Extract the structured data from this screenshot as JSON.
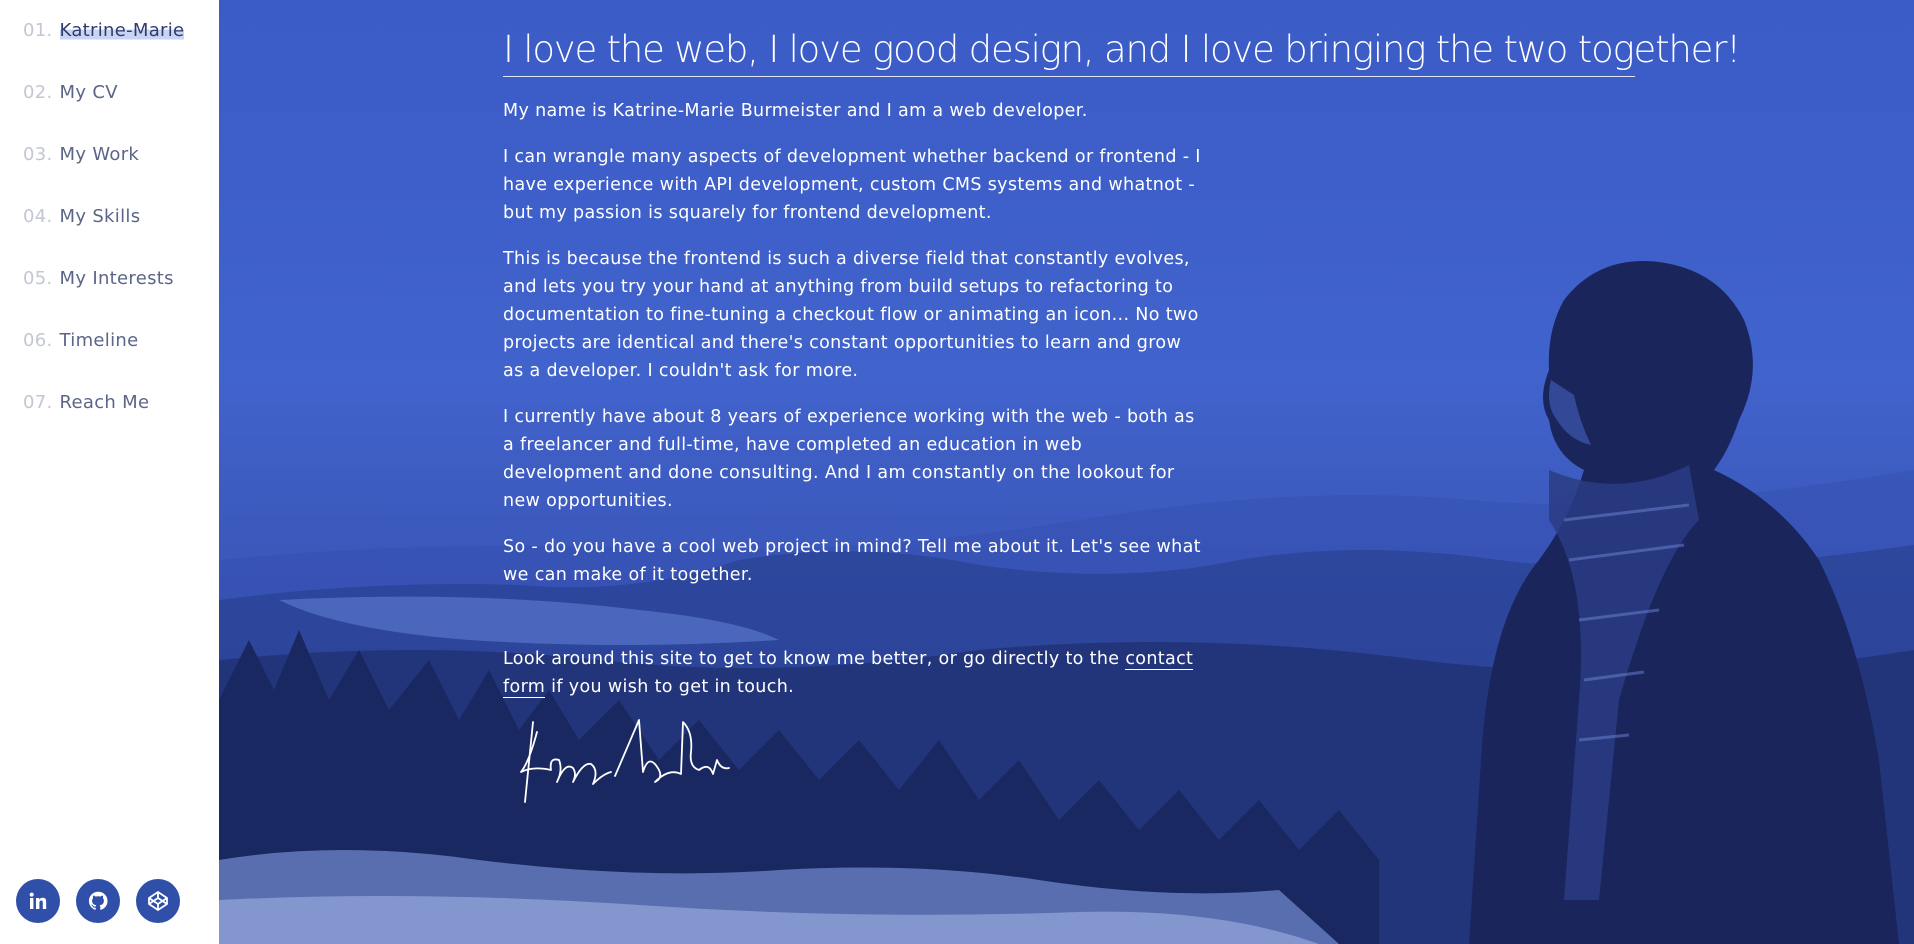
{
  "nav": {
    "items": [
      {
        "num": "01.",
        "label": "Katrine-Marie"
      },
      {
        "num": "02.",
        "label": "My CV"
      },
      {
        "num": "03.",
        "label": "My Work"
      },
      {
        "num": "04.",
        "label": "My Skills"
      },
      {
        "num": "05.",
        "label": "My Interests"
      },
      {
        "num": "06.",
        "label": "Timeline"
      },
      {
        "num": "07.",
        "label": "Reach Me"
      }
    ],
    "active_index": 0
  },
  "socials": [
    {
      "icon": "linkedin-icon"
    },
    {
      "icon": "github-icon"
    },
    {
      "icon": "codepen-icon"
    }
  ],
  "main": {
    "headline": "I love the web, I love good design, and I love bringing the two together!",
    "paragraphs": [
      "My name is Katrine-Marie Burmeister and I am a web developer.",
      "I can wrangle many aspects of development whether backend or frontend - I have experience with API development, custom CMS systems and whatnot - but my passion is squarely for frontend development.",
      "This is because the frontend is such a diverse field that constantly evolves, and lets you try your hand at anything from build setups to refactoring to documentation to fine-tuning a checkout flow or animating an icon... No two projects are identical and there's constant opportunities to learn and grow as a developer. I couldn't ask for more.",
      "I currently have about 8 years of experience working with the web - both as a freelancer and full-time, have completed an education in web development and done consulting. And I am constantly on the lookout for new opportunities.",
      "So - do you have a cool web project in mind? Tell me about it. Let's see what we can make of it together."
    ],
    "closing": {
      "before_link": "Look around this site to get to know me better, or go directly to the ",
      "link_text": "contact form",
      "after_link": " if you wish to get in touch."
    }
  },
  "colors": {
    "accent": "#2f4fa8",
    "hero_blue": "#4163cc",
    "nav_label": "#5b6587",
    "nav_number": "#c3c6d3"
  }
}
